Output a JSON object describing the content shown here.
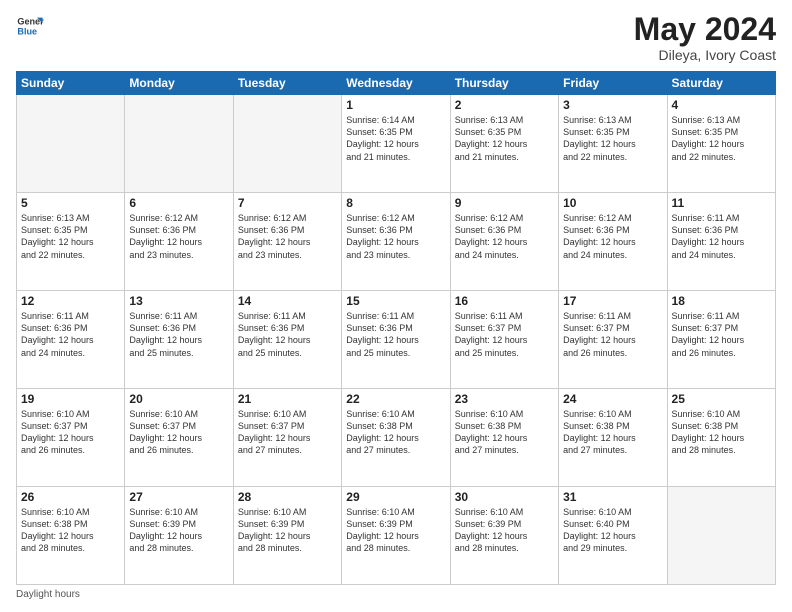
{
  "logo": {
    "line1": "General",
    "line2": "Blue"
  },
  "header": {
    "month": "May 2024",
    "location": "Dileya, Ivory Coast"
  },
  "weekdays": [
    "Sunday",
    "Monday",
    "Tuesday",
    "Wednesday",
    "Thursday",
    "Friday",
    "Saturday"
  ],
  "weeks": [
    [
      {
        "day": "",
        "info": ""
      },
      {
        "day": "",
        "info": ""
      },
      {
        "day": "",
        "info": ""
      },
      {
        "day": "1",
        "info": "Sunrise: 6:14 AM\nSunset: 6:35 PM\nDaylight: 12 hours\nand 21 minutes."
      },
      {
        "day": "2",
        "info": "Sunrise: 6:13 AM\nSunset: 6:35 PM\nDaylight: 12 hours\nand 21 minutes."
      },
      {
        "day": "3",
        "info": "Sunrise: 6:13 AM\nSunset: 6:35 PM\nDaylight: 12 hours\nand 22 minutes."
      },
      {
        "day": "4",
        "info": "Sunrise: 6:13 AM\nSunset: 6:35 PM\nDaylight: 12 hours\nand 22 minutes."
      }
    ],
    [
      {
        "day": "5",
        "info": "Sunrise: 6:13 AM\nSunset: 6:35 PM\nDaylight: 12 hours\nand 22 minutes."
      },
      {
        "day": "6",
        "info": "Sunrise: 6:12 AM\nSunset: 6:36 PM\nDaylight: 12 hours\nand 23 minutes."
      },
      {
        "day": "7",
        "info": "Sunrise: 6:12 AM\nSunset: 6:36 PM\nDaylight: 12 hours\nand 23 minutes."
      },
      {
        "day": "8",
        "info": "Sunrise: 6:12 AM\nSunset: 6:36 PM\nDaylight: 12 hours\nand 23 minutes."
      },
      {
        "day": "9",
        "info": "Sunrise: 6:12 AM\nSunset: 6:36 PM\nDaylight: 12 hours\nand 24 minutes."
      },
      {
        "day": "10",
        "info": "Sunrise: 6:12 AM\nSunset: 6:36 PM\nDaylight: 12 hours\nand 24 minutes."
      },
      {
        "day": "11",
        "info": "Sunrise: 6:11 AM\nSunset: 6:36 PM\nDaylight: 12 hours\nand 24 minutes."
      }
    ],
    [
      {
        "day": "12",
        "info": "Sunrise: 6:11 AM\nSunset: 6:36 PM\nDaylight: 12 hours\nand 24 minutes."
      },
      {
        "day": "13",
        "info": "Sunrise: 6:11 AM\nSunset: 6:36 PM\nDaylight: 12 hours\nand 25 minutes."
      },
      {
        "day": "14",
        "info": "Sunrise: 6:11 AM\nSunset: 6:36 PM\nDaylight: 12 hours\nand 25 minutes."
      },
      {
        "day": "15",
        "info": "Sunrise: 6:11 AM\nSunset: 6:36 PM\nDaylight: 12 hours\nand 25 minutes."
      },
      {
        "day": "16",
        "info": "Sunrise: 6:11 AM\nSunset: 6:37 PM\nDaylight: 12 hours\nand 25 minutes."
      },
      {
        "day": "17",
        "info": "Sunrise: 6:11 AM\nSunset: 6:37 PM\nDaylight: 12 hours\nand 26 minutes."
      },
      {
        "day": "18",
        "info": "Sunrise: 6:11 AM\nSunset: 6:37 PM\nDaylight: 12 hours\nand 26 minutes."
      }
    ],
    [
      {
        "day": "19",
        "info": "Sunrise: 6:10 AM\nSunset: 6:37 PM\nDaylight: 12 hours\nand 26 minutes."
      },
      {
        "day": "20",
        "info": "Sunrise: 6:10 AM\nSunset: 6:37 PM\nDaylight: 12 hours\nand 26 minutes."
      },
      {
        "day": "21",
        "info": "Sunrise: 6:10 AM\nSunset: 6:37 PM\nDaylight: 12 hours\nand 27 minutes."
      },
      {
        "day": "22",
        "info": "Sunrise: 6:10 AM\nSunset: 6:38 PM\nDaylight: 12 hours\nand 27 minutes."
      },
      {
        "day": "23",
        "info": "Sunrise: 6:10 AM\nSunset: 6:38 PM\nDaylight: 12 hours\nand 27 minutes."
      },
      {
        "day": "24",
        "info": "Sunrise: 6:10 AM\nSunset: 6:38 PM\nDaylight: 12 hours\nand 27 minutes."
      },
      {
        "day": "25",
        "info": "Sunrise: 6:10 AM\nSunset: 6:38 PM\nDaylight: 12 hours\nand 28 minutes."
      }
    ],
    [
      {
        "day": "26",
        "info": "Sunrise: 6:10 AM\nSunset: 6:38 PM\nDaylight: 12 hours\nand 28 minutes."
      },
      {
        "day": "27",
        "info": "Sunrise: 6:10 AM\nSunset: 6:39 PM\nDaylight: 12 hours\nand 28 minutes."
      },
      {
        "day": "28",
        "info": "Sunrise: 6:10 AM\nSunset: 6:39 PM\nDaylight: 12 hours\nand 28 minutes."
      },
      {
        "day": "29",
        "info": "Sunrise: 6:10 AM\nSunset: 6:39 PM\nDaylight: 12 hours\nand 28 minutes."
      },
      {
        "day": "30",
        "info": "Sunrise: 6:10 AM\nSunset: 6:39 PM\nDaylight: 12 hours\nand 28 minutes."
      },
      {
        "day": "31",
        "info": "Sunrise: 6:10 AM\nSunset: 6:40 PM\nDaylight: 12 hours\nand 29 minutes."
      },
      {
        "day": "",
        "info": ""
      }
    ]
  ],
  "footer": {
    "daylight_label": "Daylight hours"
  },
  "colors": {
    "header_bg": "#1a6ab1",
    "header_text": "#ffffff",
    "border": "#cccccc",
    "empty_bg": "#f5f5f5"
  }
}
